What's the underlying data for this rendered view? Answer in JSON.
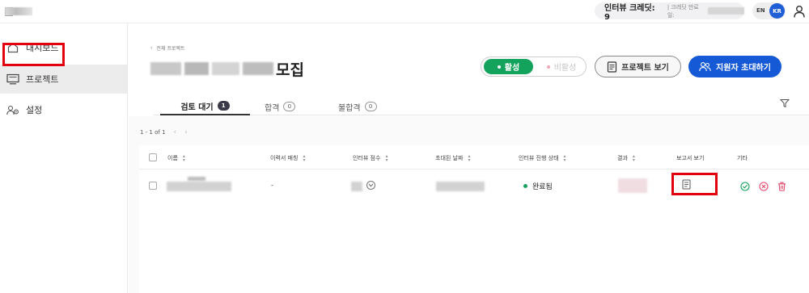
{
  "topbar": {
    "credit_label": "인터뷰 크레딧: 9",
    "expiry_label": "| 크레딧 만료일:",
    "lang_en": "EN",
    "lang_kr": "KR"
  },
  "sidebar": {
    "items": [
      {
        "label": "대시보드",
        "icon": "home-icon"
      },
      {
        "label": "프로젝트",
        "icon": "monitor-icon"
      },
      {
        "label": "설정",
        "icon": "users-gear-icon"
      }
    ]
  },
  "header": {
    "breadcrumb": "전체 프로젝트",
    "title_suffix": "모집",
    "status_active": "활성",
    "status_inactive": "비활성",
    "view_project": "프로젝트 보기",
    "invite_applicants": "지원자 초대하기"
  },
  "tabs": [
    {
      "label": "검토 대기",
      "count": "1"
    },
    {
      "label": "합격",
      "count": "0"
    },
    {
      "label": "불합격",
      "count": "0"
    }
  ],
  "pager": {
    "text": "1 - 1 of 1"
  },
  "table": {
    "columns": [
      "이름",
      "이력서 매칭",
      "인터뷰 점수",
      "초대된 날짜",
      "인터뷰 진행 상태",
      "결과",
      "보고서 보기",
      "기타"
    ],
    "rows": [
      {
        "resume_match": "-",
        "interview_status": "완료됨"
      }
    ]
  },
  "colors": {
    "accent_blue": "#1559d6",
    "active_green": "#14a35c",
    "highlight_red": "#e3000f"
  }
}
